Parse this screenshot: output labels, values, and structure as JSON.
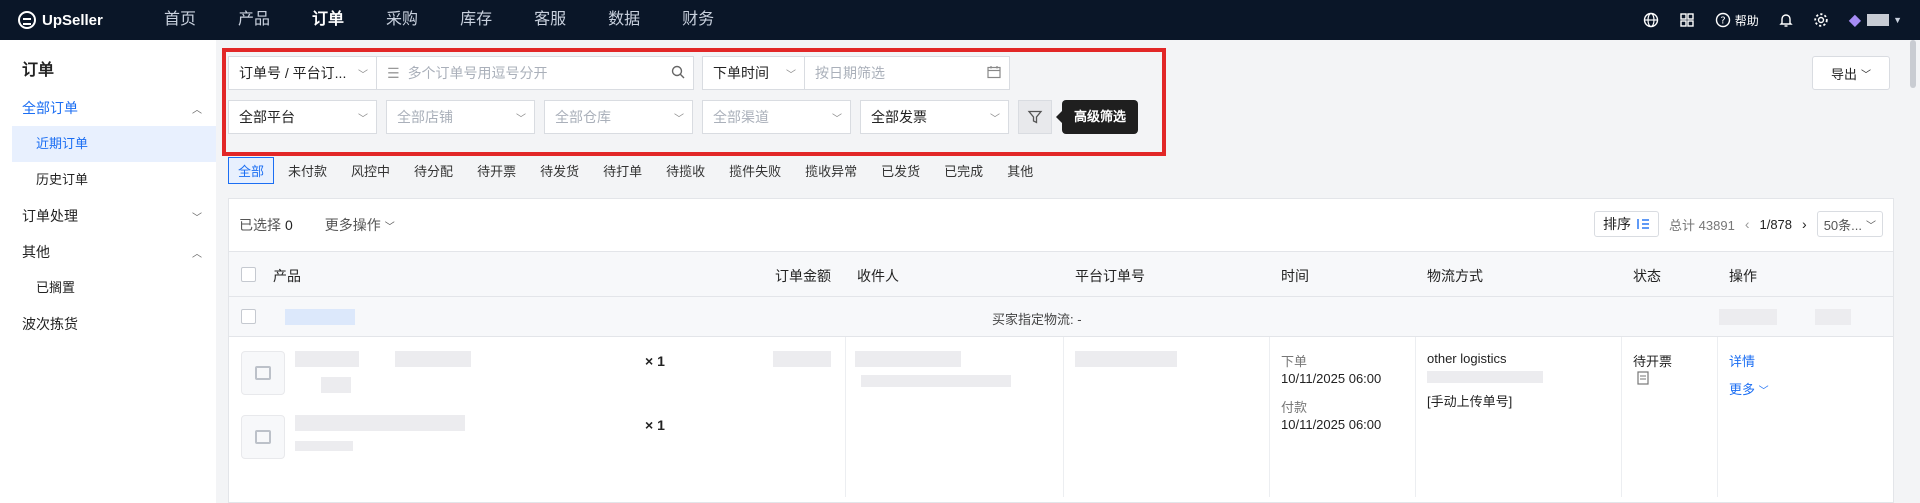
{
  "app": {
    "logo": "UpSeller"
  },
  "nav": {
    "items": [
      "首页",
      "产品",
      "订单",
      "采购",
      "库存",
      "客服",
      "数据",
      "财务"
    ],
    "active": "订单"
  },
  "topbar": {
    "help": "帮助"
  },
  "sidebar": {
    "title": "订单",
    "groups": [
      {
        "label": "全部订单",
        "expanded": true,
        "items": [
          "近期订单",
          "历史订单"
        ]
      },
      {
        "label": "订单处理",
        "expanded": false,
        "items": []
      },
      {
        "label": "其他",
        "expanded": true,
        "items": [
          "已搁置"
        ]
      },
      {
        "label": "波次拣货",
        "expanded": false,
        "items": []
      }
    ],
    "active_item": "近期订单"
  },
  "filters": {
    "search_type": "订单号 / 平台订...",
    "search_placeholder": "多个订单号用逗号分开",
    "time_type": "下单时间",
    "date_placeholder": "按日期筛选",
    "platform": "全部平台",
    "store": "全部店铺",
    "warehouse": "全部仓库",
    "channel": "全部渠道",
    "invoice": "全部发票",
    "advanced_tooltip": "高级筛选"
  },
  "export": {
    "label": "导出"
  },
  "tabs": [
    "全部",
    "未付款",
    "风控中",
    "待分配",
    "待开票",
    "待发货",
    "待打单",
    "待揽收",
    "揽件失败",
    "揽收异常",
    "已发货",
    "已完成",
    "其他"
  ],
  "active_tab": "全部",
  "toolbar": {
    "selected_label": "已选择",
    "selected_count": "0",
    "more_ops": "更多操作",
    "sort": "排序",
    "total": "总计 43891",
    "page": "1/878",
    "page_size": "50条..."
  },
  "table": {
    "columns": [
      "产品",
      "订单金额",
      "收件人",
      "平台订单号",
      "时间",
      "物流方式",
      "状态",
      "操作"
    ],
    "group_label": "买家指定物流: -",
    "order": {
      "qty1": "× 1",
      "qty2": "× 1",
      "time_order_label": "下单",
      "time_order": "10/11/2025 06:00",
      "time_paid_label": "付款",
      "time_paid": "10/11/2025 06:00",
      "logistics": "other logistics",
      "tracking": "[手动上传单号]",
      "status": "待开票",
      "action_detail": "详情",
      "action_more": "更多"
    }
  }
}
